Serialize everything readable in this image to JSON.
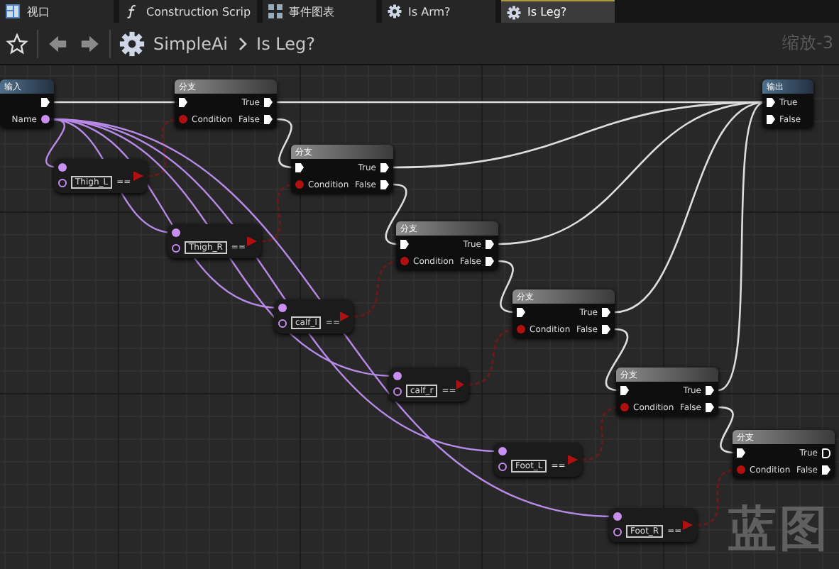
{
  "tabs": [
    {
      "label": "视口",
      "kind": "viewport",
      "selected": false
    },
    {
      "label": "Construction Scrip",
      "kind": "function",
      "selected": false
    },
    {
      "label": "事件图表",
      "kind": "graph",
      "selected": false
    },
    {
      "label": "Is Arm?",
      "kind": "gear",
      "selected": false
    },
    {
      "label": "Is Leg?",
      "kind": "gear",
      "selected": true
    }
  ],
  "toolbar": {
    "breadcrumb": [
      "SimpleAi",
      "Is Leg?"
    ],
    "zoom_label": "缩放-3"
  },
  "graph": {
    "entry_node": {
      "title": "输入",
      "pin": "Name"
    },
    "branch_nodes": [
      {
        "title": "分支",
        "true_pin": "True",
        "false_pin": "False",
        "condition_pin": "Condition",
        "true_connected": true
      },
      {
        "title": "分支",
        "true_pin": "True",
        "false_pin": "False",
        "condition_pin": "Condition",
        "true_connected": true
      },
      {
        "title": "分支",
        "true_pin": "True",
        "false_pin": "False",
        "condition_pin": "Condition",
        "true_connected": true
      },
      {
        "title": "分支",
        "true_pin": "True",
        "false_pin": "False",
        "condition_pin": "Condition",
        "true_connected": true
      },
      {
        "title": "分支",
        "true_pin": "True",
        "false_pin": "False",
        "condition_pin": "Condition",
        "true_connected": true
      },
      {
        "title": "分支",
        "true_pin": "True",
        "false_pin": "False",
        "condition_pin": "Condition",
        "true_connected": false
      }
    ],
    "compare_nodes": [
      {
        "title": "==",
        "value": "Thigh_L"
      },
      {
        "title": "==",
        "value": "Thigh_R"
      },
      {
        "title": "==",
        "value": "calf_l"
      },
      {
        "title": "==",
        "value": "calf_r"
      },
      {
        "title": "==",
        "value": "Foot_L"
      },
      {
        "title": "==",
        "value": "Foot_R"
      }
    ],
    "output_node": {
      "title": "输出",
      "true_pin": "True",
      "false_pin": "False"
    },
    "graph_label": "蓝图"
  }
}
